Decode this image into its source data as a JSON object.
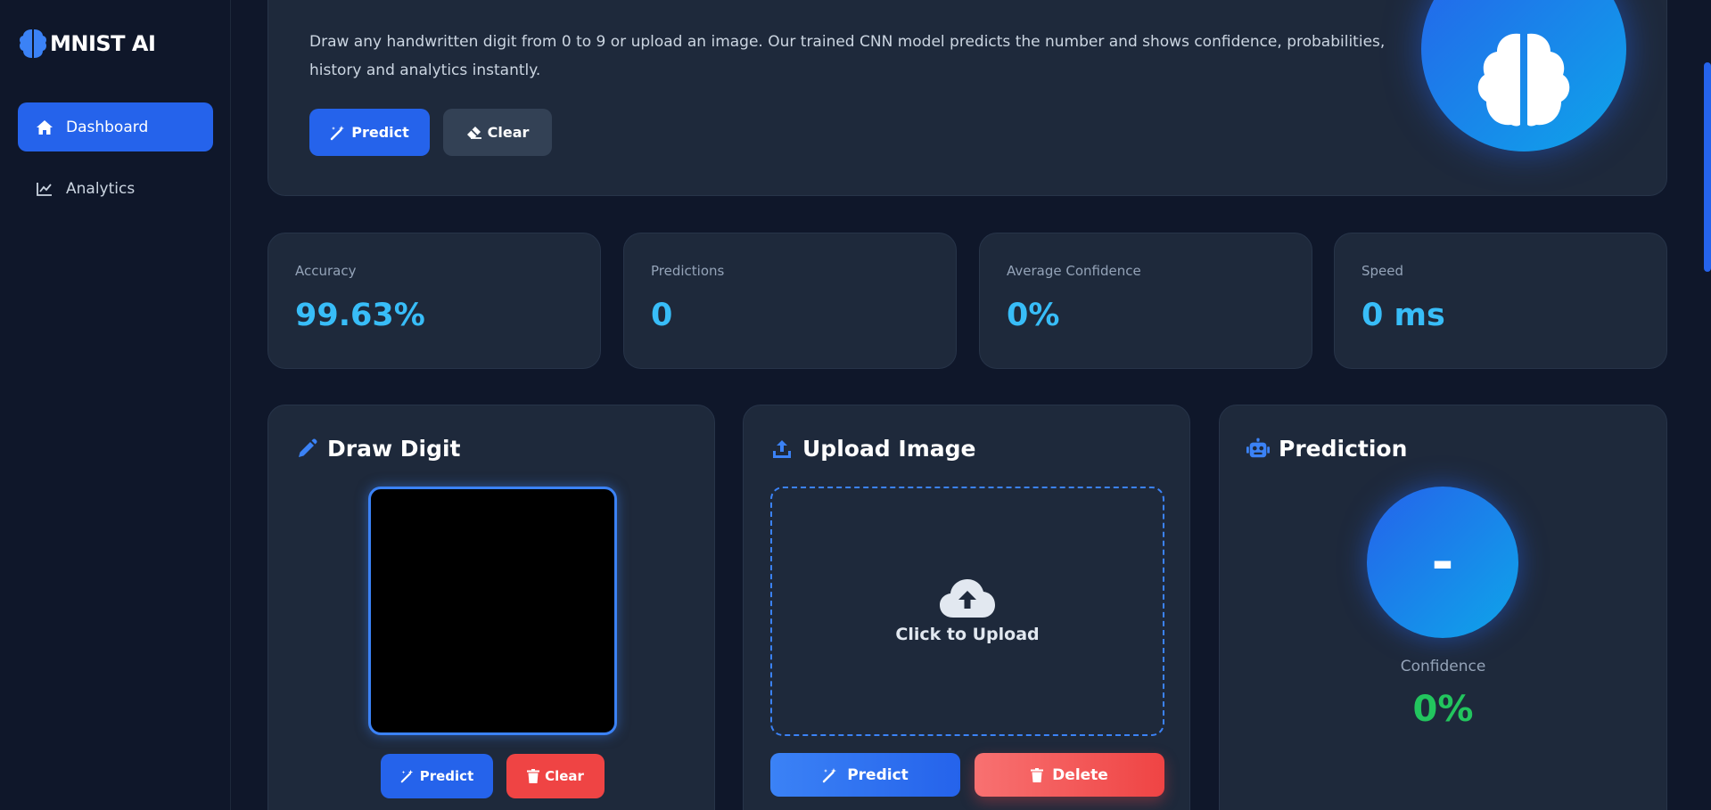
{
  "app": {
    "name": "MNIST AI"
  },
  "sidebar": {
    "items": [
      {
        "label": "Dashboard",
        "icon": "home-icon",
        "active": true
      },
      {
        "label": "Analytics",
        "icon": "chart-line-icon",
        "active": false
      }
    ]
  },
  "hero": {
    "description": "Draw any handwritten digit from 0 to 9 or upload an image. Our trained CNN model predicts the number and shows confidence, probabilities, history and analytics instantly.",
    "predict_label": "Predict",
    "clear_label": "Clear"
  },
  "stats": [
    {
      "label": "Accuracy",
      "value": "99.63%"
    },
    {
      "label": "Predictions",
      "value": "0"
    },
    {
      "label": "Average Confidence",
      "value": "0%"
    },
    {
      "label": "Speed",
      "value": "0 ms"
    }
  ],
  "draw": {
    "title": "Draw Digit",
    "predict_label": "Predict",
    "clear_label": "Clear"
  },
  "upload": {
    "title": "Upload Image",
    "zone_text": "Click to Upload",
    "predict_label": "Predict",
    "delete_label": "Delete"
  },
  "prediction": {
    "title": "Prediction",
    "digit": "-",
    "confidence_label": "Confidence",
    "confidence_value": "0%"
  },
  "colors": {
    "background": "#0f172a",
    "card": "#1e293b",
    "accent": "#2563eb",
    "stat_value": "#38bdf8",
    "danger": "#ef4444",
    "success": "#22c55e"
  }
}
